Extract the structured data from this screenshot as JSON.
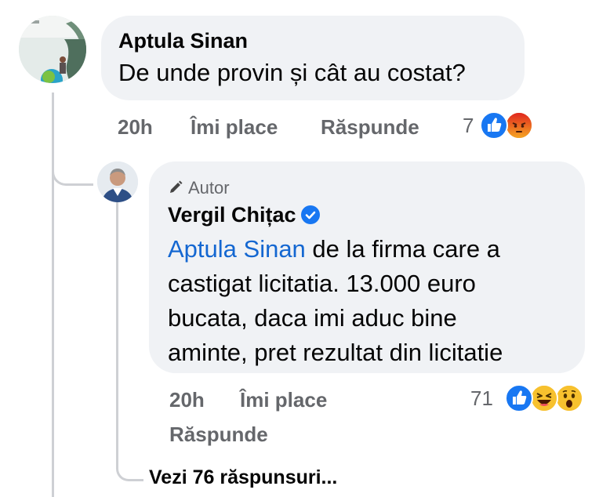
{
  "comment": {
    "author": "Aptula Sinan",
    "text": "De unde provin și cât au costat?",
    "time": "20h",
    "like_label": "Îmi place",
    "reply_label": "Răspunde",
    "reaction_count": "7",
    "reactions": [
      "like-reaction-icon",
      "angry-reaction-icon"
    ]
  },
  "reply": {
    "author_badge": "Autor",
    "author": "Vergil Chițac",
    "mention": "Aptula Sinan",
    "line1": " de la firma care a",
    "line2": "castigat licitatia. 13.000 euro",
    "line3": "bucata, daca imi aduc bine",
    "line4": "aminte, pret rezultat din licitatie",
    "time": "20h",
    "like_label": "Îmi place",
    "reply_label": "Răspunde",
    "reaction_count": "71",
    "reactions": [
      "like-reaction-icon",
      "haha-reaction-icon",
      "wow-reaction-icon"
    ]
  },
  "view_more": "Vezi 76 răspunsuri...",
  "colors": {
    "bubble_bg": "#f0f2f5",
    "mention": "#1467d1",
    "meta_text": "#65676b",
    "like_blue": "#1877f2",
    "angry_orange": "#e9710f",
    "haha_yellow": "#f7b928"
  }
}
